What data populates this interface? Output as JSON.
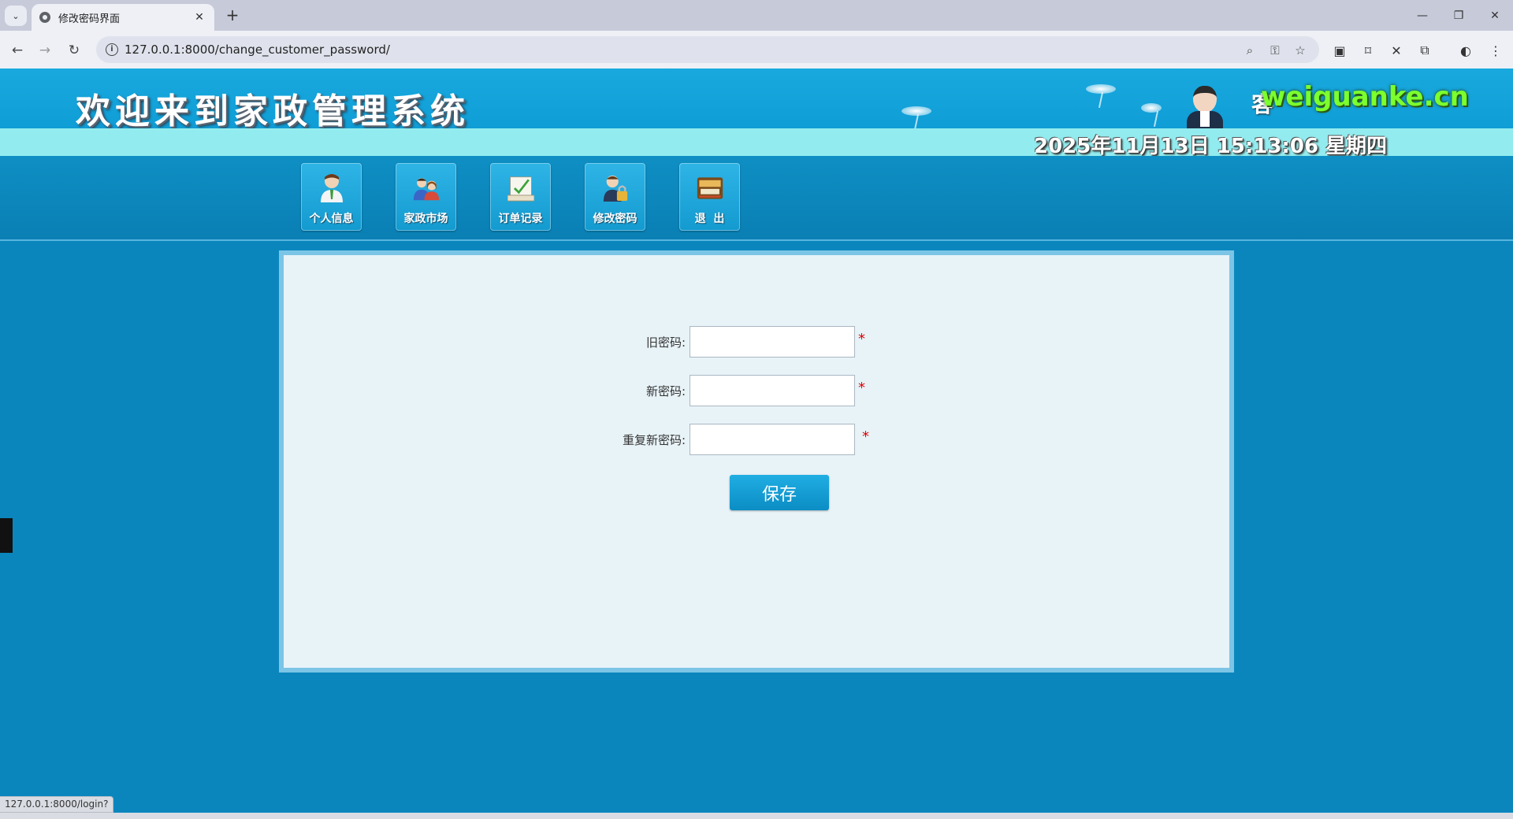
{
  "browser": {
    "tab_title": "修改密码界面",
    "url": "127.0.0.1:8000/change_customer_password/",
    "status_url": "127.0.0.1:8000/login?"
  },
  "header": {
    "system_title": "欢迎来到家政管理系统",
    "greeting_prefix": "客",
    "site_name": "weiguanke.cn",
    "datetime": "2025年11月13日 15:13:06 星期四"
  },
  "nav": [
    {
      "label": "个人信息",
      "icon": "user-icon"
    },
    {
      "label": "家政市场",
      "icon": "users-icon"
    },
    {
      "label": "订单记录",
      "icon": "order-record-icon"
    },
    {
      "label": "修改密码",
      "icon": "user-lock-icon"
    },
    {
      "label": "退  出",
      "icon": "exit-icon"
    }
  ],
  "form": {
    "old_password_label": "旧密码:",
    "new_password_label": "新密码:",
    "repeat_password_label": "重复新密码:",
    "required_mark": "*",
    "old_password_value": "",
    "new_password_value": "",
    "repeat_password_value": "",
    "save_label": "保存"
  },
  "colors": {
    "header_blue": "#19a9de",
    "strip_cyan": "#92ecef",
    "nav_blue": "#0e8fc4",
    "panel_bg": "#e8f3f8",
    "panel_border": "#7cc5e6",
    "site_name_green": "#7cff2e",
    "required_red": "#e00000"
  }
}
